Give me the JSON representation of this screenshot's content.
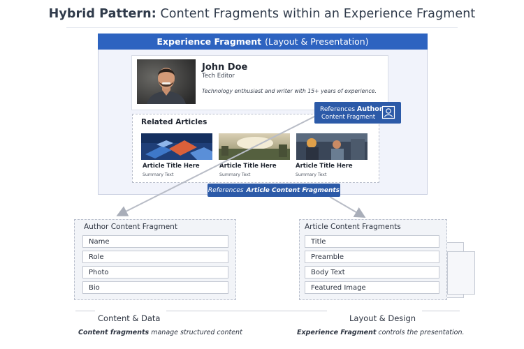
{
  "title": {
    "strong": "Hybrid Pattern:",
    "rest": "Content Fragments within an Experience Fragment"
  },
  "experience_fragment": {
    "strong": "Experience Fragment",
    "rest": "(Layout & Presentation)"
  },
  "author": {
    "name": "John Doe",
    "role": "Tech Editor",
    "bio": "Technology enthusiast and writer with 15+ years of experience."
  },
  "ref_author": {
    "prefix": "References",
    "strong": "Author",
    "line2": "Content Fragment"
  },
  "related": {
    "title": "Related Articles",
    "articles": [
      {
        "title": "Article Title Here",
        "summary": "Summary Text"
      },
      {
        "title": "Article Title Here",
        "summary": "Summary Text"
      },
      {
        "title": "Article Title Here",
        "summary": "Summary Text"
      }
    ]
  },
  "ref_articles": {
    "prefix": "References",
    "strong": "Article Content Fragments"
  },
  "author_fragment": {
    "title": "Author Content Fragment",
    "fields": [
      "Name",
      "Role",
      "Photo",
      "Bio"
    ]
  },
  "article_fragment": {
    "title": "Article Content Fragments",
    "fields": [
      "Title",
      "Preamble",
      "Body Text",
      "Featured Image"
    ]
  },
  "footer": {
    "left": {
      "heading": "Content & Data",
      "strong": "Content fragments",
      "rest": "manage structured content"
    },
    "right": {
      "heading": "Layout & Design",
      "strong": "Experience Fragment",
      "rest": "controls the presentation."
    }
  },
  "colors": {
    "accent": "#2d63c0",
    "badge": "#2c5aa8",
    "panel": "#f1f3fb",
    "connector": "#b8bcc6"
  }
}
